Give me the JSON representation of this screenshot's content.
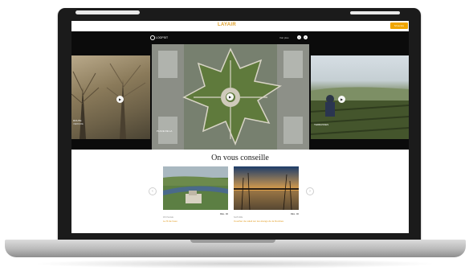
{
  "site": {
    "logo": "LAYAIR",
    "cta_label": "S'inscrire"
  },
  "hero": {
    "brand": "LOOPSIT",
    "meta": "Voir plus",
    "prev": "‹",
    "next": "›",
    "slides": [
      {
        "caption": "ROUTE",
        "subcaption": "VERDURE"
      },
      {
        "caption": "PLACE DE LA",
        "subcaption": ""
      },
      {
        "caption": "TERRASSES",
        "subcaption": ""
      }
    ]
  },
  "recommend": {
    "title": "On vous conseille",
    "prev": "‹",
    "next": "›",
    "cards": [
      {
        "tag": "PAYSAGE",
        "title": "Le fil de l'eau",
        "meta": "REL. 00"
      },
      {
        "tag": "NATURE",
        "title": "Coucher de soleil sur les étangs de la Dombes",
        "meta": "REL. 00"
      }
    ]
  },
  "colors": {
    "accent": "#f0a500",
    "hero_bg": "#0b0b0b"
  }
}
